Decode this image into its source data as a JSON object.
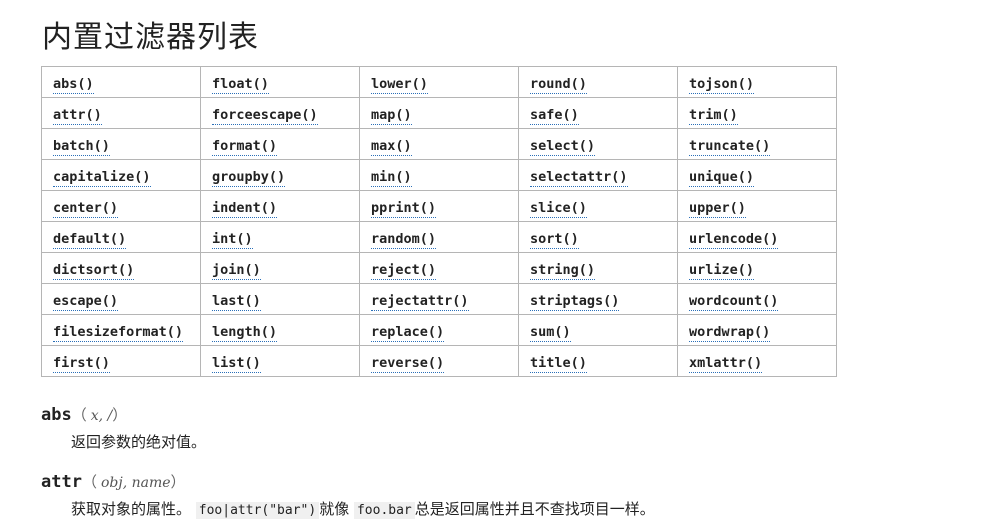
{
  "title": "内置过滤器列表",
  "table": {
    "rows": [
      [
        "abs()",
        "float()",
        "lower()",
        "round()",
        "tojson()"
      ],
      [
        "attr()",
        "forceescape()",
        "map()",
        "safe()",
        "trim()"
      ],
      [
        "batch()",
        "format()",
        "max()",
        "select()",
        "truncate()"
      ],
      [
        "capitalize()",
        "groupby()",
        "min()",
        "selectattr()",
        "unique()"
      ],
      [
        "center()",
        "indent()",
        "pprint()",
        "slice()",
        "upper()"
      ],
      [
        "default()",
        "int()",
        "random()",
        "sort()",
        "urlencode()"
      ],
      [
        "dictsort()",
        "join()",
        "reject()",
        "string()",
        "urlize()"
      ],
      [
        "escape()",
        "last()",
        "rejectattr()",
        "striptags()",
        "wordcount()"
      ],
      [
        "filesizeformat()",
        "length()",
        "replace()",
        "sum()",
        "wordwrap()"
      ],
      [
        "first()",
        "list()",
        "reverse()",
        "title()",
        "xmlattr()"
      ]
    ]
  },
  "abs": {
    "name": "abs",
    "open": "（",
    "params": "x, /",
    "close": "）",
    "desc": "返回参数的绝对值。"
  },
  "attr": {
    "name": "attr",
    "open": "（",
    "params": "obj, name",
    "close": "）",
    "desc_pre": "获取对象的属性。 ",
    "code1": "foo|attr(\"bar\")",
    "desc_mid": "就像 ",
    "code2": "foo.bar",
    "desc_post": "总是返回属性并且不查找项目一样。"
  }
}
